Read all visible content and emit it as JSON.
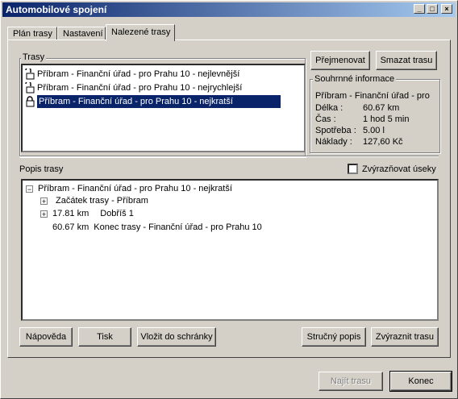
{
  "window": {
    "title": "Automobilové spojení"
  },
  "tabs": [
    {
      "label": "Plán trasy"
    },
    {
      "label": "Nastavení"
    },
    {
      "label": "Nalezené trasy"
    }
  ],
  "routes": {
    "label": "Trasy",
    "items": [
      {
        "label": "Příbram - Finanční úřad - pro Prahu 10 - nejlevnější"
      },
      {
        "label": "Příbram - Finanční úřad - pro Prahu 10 - nejrychlejší"
      },
      {
        "label": "Příbram - Finanční úřad - pro Prahu 10 - nejkratší"
      }
    ]
  },
  "actions": {
    "rename": "Přejmenovat",
    "delete": "Smazat trasu"
  },
  "summary": {
    "label": "Souhrnné informace",
    "name": "Příbram - Finanční úřad - pro",
    "length_label": "Délka :",
    "length_value": "60.67  km",
    "time_label": "Čas :",
    "time_value": "1 hod 5 min",
    "consumption_label": "Spotřeba :",
    "consumption_value": "5.00 l",
    "cost_label": "Náklady :",
    "cost_value": "127,60 Kč"
  },
  "description": {
    "label": "Popis trasy",
    "highlight_label": "Zvýrazňovat úseky",
    "root": "Příbram - Finanční úřad - pro Prahu 10 - nejkratší",
    "start": "Začátek trasy - Příbram",
    "step_dist": "17.81 km",
    "step_text": "Dobříš 1",
    "end_dist": "60.67  km",
    "end_text": "Konec trasy - Finanční úřad - pro Prahu 10"
  },
  "bottom_buttons": {
    "help": "Nápověda",
    "print": "Tisk",
    "clipboard": "Vložit do schránky",
    "brief": "Stručný popis",
    "highlight": "Zvýraznit trasu"
  },
  "footer": {
    "find": "Najít trasu",
    "close": "Konec"
  }
}
